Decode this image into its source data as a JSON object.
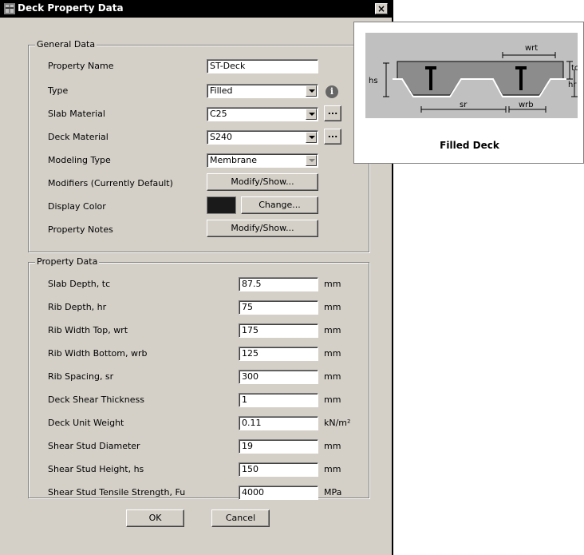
{
  "window": {
    "title": "Deck Property Data",
    "close_label": "×"
  },
  "general": {
    "title": "General Data",
    "property_name": {
      "label": "Property Name",
      "value": "ST-Deck"
    },
    "type": {
      "label": "Type",
      "value": "Filled"
    },
    "slab_material": {
      "label": "Slab Material",
      "value": "C25",
      "browse": "..."
    },
    "deck_material": {
      "label": "Deck Material",
      "value": "S240",
      "browse": "..."
    },
    "modeling_type": {
      "label": "Modeling Type",
      "value": "Membrane"
    },
    "modifiers": {
      "label": "Modifiers (Currently Default)",
      "button": "Modify/Show..."
    },
    "display_color": {
      "label": "Display Color",
      "button": "Change...",
      "color": "#1a1a1a"
    },
    "property_notes": {
      "label": "Property Notes",
      "button": "Modify/Show..."
    }
  },
  "property": {
    "title": "Property Data",
    "rows": [
      {
        "label": "Slab Depth, tc",
        "value": "87.5",
        "unit": "mm"
      },
      {
        "label": "Rib Depth, hr",
        "value": "75",
        "unit": "mm"
      },
      {
        "label": "Rib Width Top, wrt",
        "value": "175",
        "unit": "mm"
      },
      {
        "label": "Rib Width Bottom, wrb",
        "value": "125",
        "unit": "mm"
      },
      {
        "label": "Rib Spacing, sr",
        "value": "300",
        "unit": "mm"
      },
      {
        "label": "Deck Shear Thickness",
        "value": "1",
        "unit": "mm"
      },
      {
        "label": "Deck Unit Weight",
        "value": "0.11",
        "unit": "kN/m²"
      },
      {
        "label": "Shear Stud Diameter",
        "value": "19",
        "unit": "mm"
      },
      {
        "label": "Shear Stud Height, hs",
        "value": "150",
        "unit": "mm"
      },
      {
        "label": "Shear Stud Tensile Strength, Fu",
        "value": "4000",
        "unit": "MPa"
      }
    ]
  },
  "buttons": {
    "ok": "OK",
    "cancel": "Cancel"
  },
  "preview": {
    "caption": "Filled Deck",
    "dims": {
      "wrt": "wrt",
      "tc": "tc",
      "hs": "hs",
      "hr": "hr",
      "sr": "sr",
      "wrb": "wrb"
    }
  },
  "icons": {
    "info": "info-icon",
    "app": "app-icon",
    "close": "close-icon"
  }
}
